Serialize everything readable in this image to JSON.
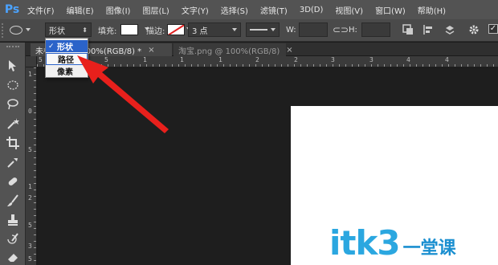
{
  "app": {
    "logo": "Ps"
  },
  "menu": [
    "文件(F)",
    "编辑(E)",
    "图像(I)",
    "图层(L)",
    "文字(Y)",
    "选择(S)",
    "滤镜(T)",
    "3D(D)",
    "视图(V)",
    "窗口(W)",
    "帮助(H)"
  ],
  "options": {
    "mode_value": "形状",
    "fill_label": "填充:",
    "stroke_label": "描边:",
    "stroke_width": "3 点",
    "w_label": "W:",
    "h_label": "H:",
    "fill_color": "#ffffff"
  },
  "tabs": [
    {
      "label": "未标题-1 @ 100%(RGB/8) *",
      "close": "×"
    },
    {
      "label": "淘宝.png @ 100%(RGB/8)",
      "close": "×"
    }
  ],
  "dropdown": {
    "items": [
      "形状",
      "路径",
      "像素"
    ],
    "selected_index": 0,
    "check": "✓"
  },
  "ruler_top": [
    "5",
    "0",
    "5",
    "1",
    "1",
    "1",
    "2",
    "2",
    "3",
    "3",
    "4",
    "4"
  ],
  "ruler_left": [
    "1",
    "0",
    "5",
    "1",
    "2",
    "5",
    "3",
    "5"
  ],
  "watermark": {
    "text": "itk3",
    "cn": "一堂课"
  },
  "colors": {
    "menubar": "#535353",
    "accent_arrow": "#e8201c",
    "selection": "#2b63c9",
    "watermark": "#2ba7e0"
  }
}
